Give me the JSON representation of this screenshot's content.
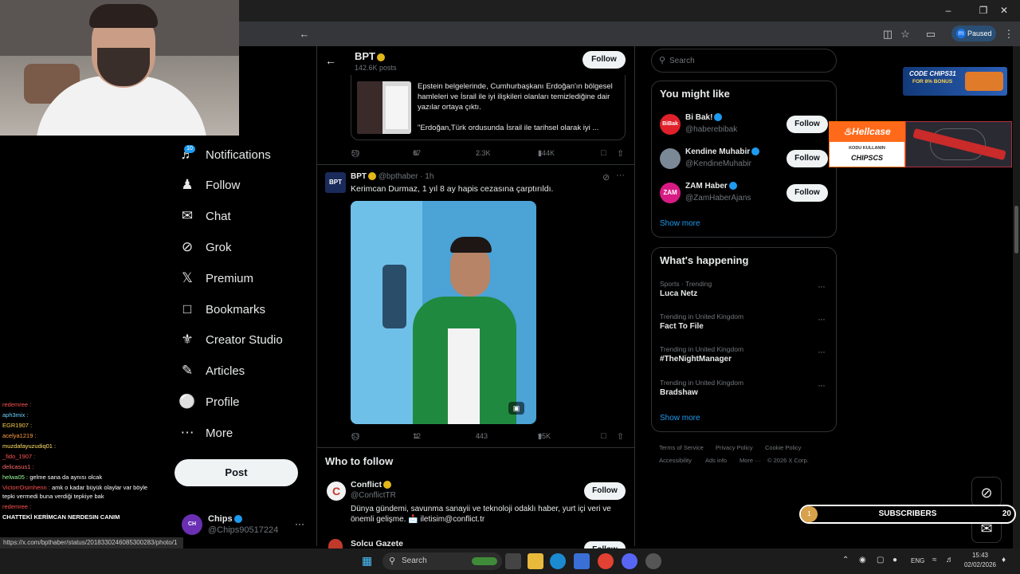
{
  "browser": {
    "profile_label": "Paused",
    "profile_initial": "m"
  },
  "nav": {
    "notifications_badge": "10",
    "items": [
      "Notifications",
      "Follow",
      "Chat",
      "Grok",
      "Premium",
      "Bookmarks",
      "Creator Studio",
      "Articles",
      "Profile",
      "More"
    ],
    "post_label": "Post",
    "account_name": "Chips",
    "account_handle": "@Chips90517224"
  },
  "header": {
    "title": "BPT",
    "post_count": "142.6K posts",
    "follow_label": "Follow"
  },
  "tweet1": {
    "card_text": "Epstein belgelerinde, Cumhurbaşkanı Erdoğan'ın bölgesel hamleleri ve İsrail ile iyi ilişkileri olanları temizlediğine dair yazılar ortaya çıktı.",
    "card_quote": "\"Erdoğan,Türk ordusunda İsrail ile tarihsel olarak iyi ...",
    "replies": "59",
    "reposts": "67",
    "likes": "2.3K",
    "views": "344K"
  },
  "tweet2": {
    "name": "BPT",
    "handle": "@bpthaber",
    "time": "· 1h",
    "text": "Kerimcan Durmaz, 1 yıl 8 ay hapis cezasına çarptırıldı.",
    "replies": "63",
    "reposts": "12",
    "likes": "443",
    "views": "95K"
  },
  "who_to_follow": {
    "title": "Who to follow",
    "accounts": [
      {
        "name": "Conflict",
        "handle": "@ConflictTR",
        "bio": "Dünya gündemi, savunma sanayii ve teknoloji odaklı haber, yurt içi veri ve önemli gelişme. 📩 iletisim@conflict.tr",
        "follow": "Follow"
      },
      {
        "name": "Solcu Gazete",
        "follow": "Follow"
      }
    ]
  },
  "search": {
    "placeholder": "Search"
  },
  "you_might_like": {
    "title": "You might like",
    "accounts": [
      {
        "name": "Bi Bak!",
        "handle": "@haberebibak",
        "follow": "Follow"
      },
      {
        "name": "Kendine Muhabir",
        "handle": "@KendineMuhabir",
        "follow": "Follow"
      },
      {
        "name": "ZAM Haber",
        "handle": "@ZamHaberAjans",
        "follow": "Follow"
      }
    ],
    "show_more": "Show more"
  },
  "whats_happening": {
    "title": "What's happening",
    "trends": [
      {
        "meta": "Sports · Trending",
        "name": "Luca Netz"
      },
      {
        "meta": "Trending in United Kingdom",
        "name": "Fact To File"
      },
      {
        "meta": "Trending in United Kingdom",
        "name": "#TheNightManager"
      },
      {
        "meta": "Trending in United Kingdom",
        "name": "Bradshaw"
      }
    ],
    "show_more": "Show more"
  },
  "footer": [
    "Terms of Service",
    "Privacy Policy",
    "Cookie Policy",
    "Accessibility",
    "Ads info",
    "More ···",
    "© 2026 X Corp."
  ],
  "overlay": {
    "code_title": "CODE CHIPS31",
    "code_sub": "FOR 8% BONUS",
    "hellcase": "Hellcase",
    "hellcase_sub": "KODU KULLANIN",
    "hellcase_code": "CHIPSCS",
    "subscribers_label": "SUBSCRIBERS",
    "subscribers_left": "1",
    "subscribers_right": "20"
  },
  "chat": [
    {
      "user": "redemree :",
      "msg": "",
      "color": "#ff5252"
    },
    {
      "user": "aph3mix :",
      "msg": "",
      "color": "#6ad2ff"
    },
    {
      "user": "EGR1907 :",
      "msg": "",
      "color": "#ffd24d"
    },
    {
      "user": "acelya1219 :",
      "msg": "",
      "color": "#ff9f43"
    },
    {
      "user": "muzdafayuzudiq01 :",
      "msg": "",
      "color": "#ffe066"
    },
    {
      "user": "_fido_1907 :",
      "msg": "",
      "color": "#ff5252"
    },
    {
      "user": "delicasus1 :",
      "msg": "",
      "color": "#ff6b6b"
    },
    {
      "user": "helwa05 :",
      "msg": "gelme sana da aynısı olcak",
      "color": "#9bff9b"
    },
    {
      "user": "VictorrOsimhenn :",
      "msg": "amk o kadar büyük olaylar var böyle",
      "color": "#ff5252"
    },
    {
      "user": "",
      "msg": "tepki vermedi buna verdiği tepkiye bak",
      "color": "#fff"
    },
    {
      "user": "redemree :",
      "msg": "",
      "color": "#ff5252"
    },
    {
      "user": "CHATTEKİ KERİMCAN NERDESIN CANIM",
      "msg": "",
      "color": "#fff"
    }
  ],
  "status_url": "https://x.com/bpthaber/status/2018330246085300283/photo/1",
  "taskbar": {
    "search": "Search",
    "lang": "ENG",
    "time": "15:43",
    "date": "02/02/2026"
  }
}
